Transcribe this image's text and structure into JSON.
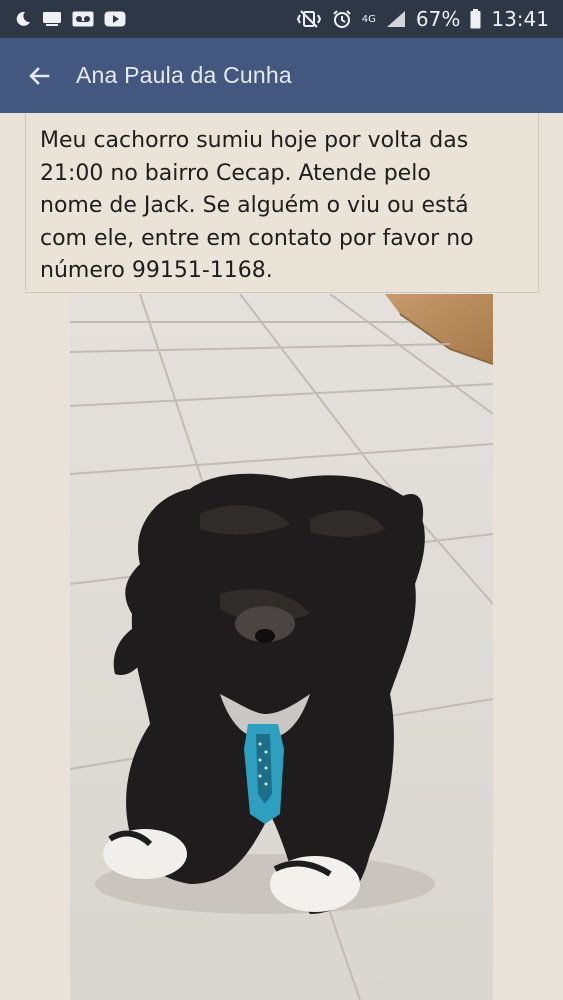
{
  "status_bar": {
    "icons_left": [
      "moon-icon",
      "keyboard-icon",
      "voicemail-icon",
      "play-icon"
    ],
    "icons_right": [
      "mute-vibrate-icon",
      "alarm-icon",
      "signal-icon",
      "battery-icon"
    ],
    "network": "4G",
    "battery": "67%",
    "time": "13:41"
  },
  "app_bar": {
    "title": "Ana Paula da Cunha",
    "color": "#44587f"
  },
  "post": {
    "line1": "Meu cachorro sumiu hoje por volta das",
    "line2": "21:00 no bairro Cecap. Atende pelo",
    "line3": "nome de Jack. Se alguém o viu ou está",
    "line4": "com ele, entre em contato por favor no",
    "line5": "número 99151-1168."
  },
  "photo": {
    "subject": "black-dog-with-blue-tie"
  }
}
